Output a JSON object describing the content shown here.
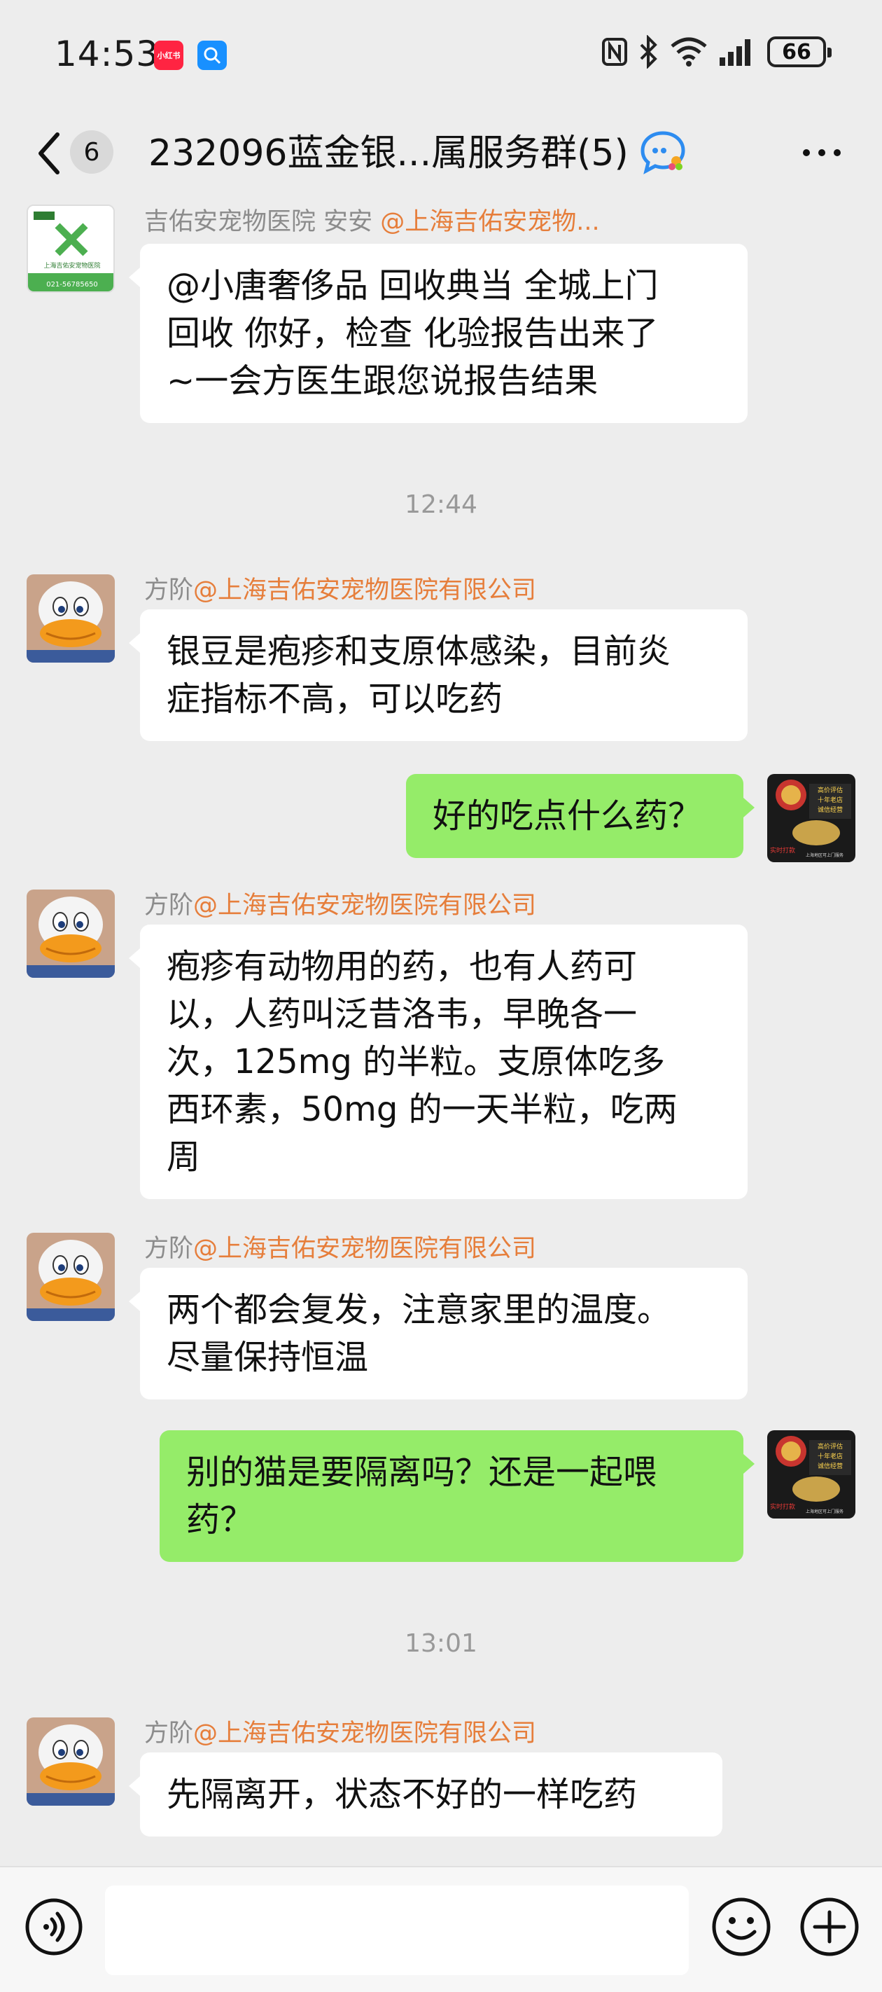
{
  "status_bar": {
    "time": "14:53",
    "app_badge_1": "小红书",
    "battery": "66"
  },
  "header": {
    "unread_count": "6",
    "title": "232096蓝金银...属服务群(5)"
  },
  "messages": [
    {
      "sender_name": "吉佑安宠物医院 安安",
      "sender_mention": "@上海吉佑安宠物...",
      "text_lines": [
        "@小唐奢侈品 回收典当 全城上门",
        "回收 你好，检查 化验报告出来了",
        "~一会方医生跟您说报告结果"
      ],
      "avatar_text": "上海吉佑安宠物医院",
      "avatar_phone": "021-56785650"
    },
    {
      "timestamp": "12:44"
    },
    {
      "sender_name": "方阶",
      "sender_mention": "@上海吉佑安宠物医院有限公司",
      "text_lines": [
        "银豆是疱疹和支原体感染，目前炎",
        "症指标不高，可以吃药"
      ]
    },
    {
      "text_lines": [
        "好的吃点什么药？"
      ]
    },
    {
      "sender_name": "方阶",
      "sender_mention": "@上海吉佑安宠物医院有限公司",
      "text_lines": [
        "疱疹有动物用的药，也有人药可",
        "以，人药叫泛昔洛韦，早晚各一",
        "次，125mg 的半粒。支原体吃多",
        "西环素，50mg 的一天半粒，吃两",
        "周"
      ]
    },
    {
      "sender_name": "方阶",
      "sender_mention": "@上海吉佑安宠物医院有限公司",
      "text_lines": [
        "两个都会复发，注意家里的温度。",
        "尽量保持恒温"
      ]
    },
    {
      "text_lines": [
        "别的猫是要隔离吗？还是一起喂",
        "药？"
      ]
    },
    {
      "timestamp": "13:01"
    },
    {
      "sender_name": "方阶",
      "sender_mention": "@上海吉佑安宠物医院有限公司",
      "text_lines": [
        "先隔离开，状态不好的一样吃药"
      ]
    }
  ],
  "own_avatar_text": [
    "高价评估",
    "十年老店",
    "诚信经营",
    "实时打款",
    "上海地区可上门服务"
  ],
  "input_bar": {
    "placeholder": ""
  },
  "colors": {
    "background": "#ededed",
    "outgoing_bubble": "#95ec69",
    "incoming_bubble": "#ffffff",
    "mention": "#e67e3b"
  }
}
